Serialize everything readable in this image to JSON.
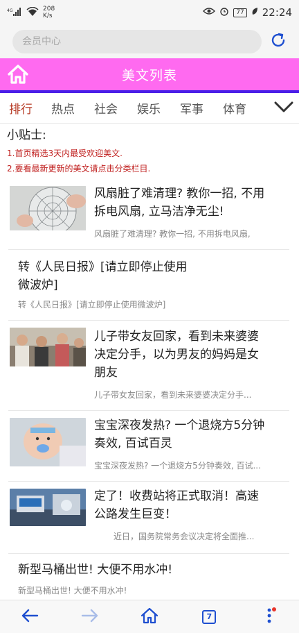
{
  "status": {
    "network": "4G",
    "speed_value": "208",
    "speed_unit": "K/s",
    "battery": "77",
    "time": "22:24"
  },
  "browser": {
    "url_placeholder": "会员中心",
    "tab_count": "7"
  },
  "header": {
    "title": "美文列表",
    "bg_color": "#ff6af0",
    "underline_color": "#4a1ee8"
  },
  "tabs": [
    {
      "label": "排行",
      "active": true
    },
    {
      "label": "热点",
      "active": false
    },
    {
      "label": "社会",
      "active": false
    },
    {
      "label": "娱乐",
      "active": false
    },
    {
      "label": "军事",
      "active": false
    },
    {
      "label": "体育",
      "active": false
    }
  ],
  "tips": {
    "title": "小贴士:",
    "lines": [
      "1.首页精选3天内最受欢迎美文.",
      "2.要看最新更新的美文请点击分类栏目."
    ]
  },
  "articles": [
    {
      "title_lines": [
        "风扇脏了难清理? 教你一招, 不用",
        "拆电风扇, 立马洁净无尘!"
      ],
      "summary": "风扇脏了难清理? 教你一招, 不用拆电风扇,",
      "image": "fan-photo"
    },
    {
      "title_lines": [
        "转《人民日报》[请立即停止使用",
        "微波炉]"
      ],
      "summary": "转《人民日报》[请立即停止使用微波炉]",
      "image": ""
    },
    {
      "title_lines": [
        "儿子带女友回家，看到未来婆婆",
        "决定分手，以为男友的妈妈是女",
        "朋友"
      ],
      "summary": "儿子带女友回家，看到未来婆婆决定分手...",
      "image": "people-photo"
    },
    {
      "title_lines": [
        "宝宝深夜发热? 一个退烧方5分钟",
        "奏效, 百试百灵"
      ],
      "summary": "宝宝深夜发热? 一个退烧方5分钟奏效, 百试...",
      "image": "baby-photo"
    },
    {
      "title_lines": [
        "定了！收费站将正式取消！高速",
        "公路发生巨变！"
      ],
      "summary": "近日，国务院常务会议决定将全面推...",
      "image": "tollbooth-photo"
    },
    {
      "title_lines": [
        "新型马桶出世! 大便不用水冲!"
      ],
      "summary": "新型马桶出世! 大便不用水冲!",
      "image": ""
    }
  ]
}
